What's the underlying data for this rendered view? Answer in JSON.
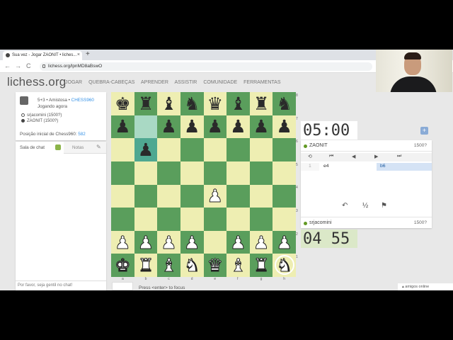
{
  "browser": {
    "tab_title": "Sua vez - Jogar ZAONIT • liches...",
    "tab_close": "×",
    "new_tab": "+",
    "back": "←",
    "forward": "→",
    "reload": "C",
    "url": "lichess.org/lpnMD8aBswO"
  },
  "site": {
    "logo": "lichess.org",
    "nav": [
      "JOGAR",
      "QUEBRA-CABEÇAS",
      "APRENDER",
      "ASSISTIR",
      "COMUNIDADE",
      "FERRAMENTAS"
    ]
  },
  "game_info": {
    "speed": "5+3 • Amistosa •",
    "variant": "CHESS960",
    "status": "Jogando agora",
    "white_player": "srjacomini (1500?)",
    "black_player": "ZAONIT (1500?)",
    "position_label": "Posição inicial de Chess960:",
    "position_number": "582"
  },
  "chat": {
    "tab_chat": "Sala de chat",
    "tab_notes": "Notas",
    "placeholder": "Por favor, seja gentil no chat!"
  },
  "board": {
    "rows": [
      [
        "bk",
        "br",
        "bb",
        "bn",
        "bq",
        "bb",
        "br",
        "bn"
      ],
      [
        "bp",
        "",
        "bp",
        "bp",
        "bp",
        "bp",
        "bp",
        "bp"
      ],
      [
        "",
        "bp",
        "",
        "",
        "",
        "",
        "",
        ""
      ],
      [
        "",
        "",
        "",
        "",
        "",
        "",
        "",
        ""
      ],
      [
        "",
        "",
        "",
        "",
        "wp",
        "",
        "",
        ""
      ],
      [
        "",
        "",
        "",
        "",
        "",
        "",
        "",
        ""
      ],
      [
        "wp",
        "wp",
        "wp",
        "wp",
        "",
        "wp",
        "wp",
        "wp"
      ],
      [
        "wk",
        "wr",
        "wb",
        "wn",
        "wq",
        "wb",
        "wr",
        "wn"
      ]
    ],
    "highlight": [
      "b7",
      "b6"
    ],
    "ranks": [
      "8",
      "7",
      "6",
      "5",
      "4",
      "3",
      "2",
      "1"
    ],
    "files": [
      "a",
      "b",
      "c",
      "d",
      "e",
      "f",
      "g",
      "h"
    ],
    "colors": {
      "light": "#eeeeb2",
      "dark": "#5a9e5c"
    }
  },
  "hint": "Press <enter> to focus",
  "clocks": {
    "opponent": "05:00",
    "player": "04 55"
  },
  "panel": {
    "opponent_name": "ZAONIT",
    "opponent_rating": "1500?",
    "player_name": "srjacomini",
    "player_rating": "1500?",
    "move_number": "1",
    "white_move": "e4",
    "black_move": "b6",
    "controls": [
      "⟲",
      "⏮",
      "◀",
      "▶",
      "⏭"
    ],
    "takeback": "↶",
    "draw": "½",
    "resign": "⚑"
  },
  "friends": "amigos online"
}
